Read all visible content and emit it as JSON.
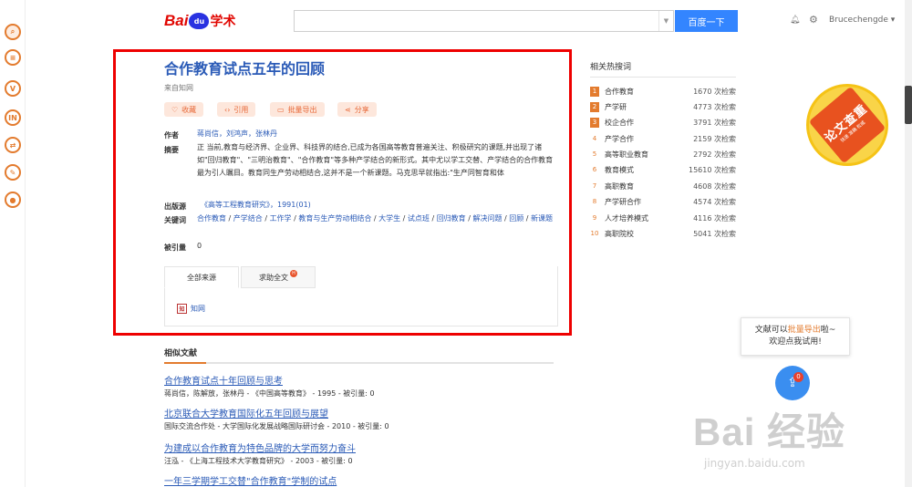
{
  "header": {
    "logo_text_a": "Bai",
    "logo_text_b": "du",
    "logo_text_c": "学术",
    "search_value": "",
    "search_button": "百度一下",
    "username": "Brucechengde ▾"
  },
  "paper": {
    "title": "合作教育试点五年的回顾",
    "source": "来自知网",
    "actions": [
      "收藏",
      "引用",
      "批量导出",
      "分享"
    ],
    "labels": {
      "authors": "作者",
      "abstract": "摘要",
      "publisher": "出版源",
      "keywords": "关键词",
      "cited": "被引量"
    },
    "authors": "蒋尚信，刘鸿声，张林丹",
    "abstract": "正 当前,教育与经济界、企业界、科技界的结合,已成为各国高等教育普遍关注、积极研究的课题,并出现了诸如\"回归教育\"、\"三明治教育\"、\"合作教育\"等多种产学结合的新形式。其中尤以学工交替、产学结合的合作教育最为引人瞩目。教育同生产劳动相结合,这并不是一个新课题。马克思早就指出:\"生产同智育和体",
    "publisher": "《高等工程教育研究》，1991(01)",
    "keywords": [
      "合作教育",
      "产学结合",
      "工作学",
      "教育与生产劳动相结合",
      "大学生",
      "试点班",
      "回归教育",
      "解决问题",
      "回顾",
      "新课题"
    ],
    "cited": "0",
    "tabs": [
      "全部来源",
      "求助全文"
    ],
    "tab_badge": "H",
    "source_link": "知网",
    "source_logo": "知"
  },
  "similar": {
    "heading": "相似文献",
    "items": [
      {
        "title": "合作教育试点十年回顾与思考",
        "meta": "蒋尚信，陈解放，张林丹 - 《中国高等教育》 - 1995 - 被引量: 0"
      },
      {
        "title": "北京联合大学教育国际化五年回顾与展望",
        "meta": "国际交流合作处 - 大学国际化发展战略国际研讨会 - 2010 - 被引量: 0"
      },
      {
        "title": "为建成以合作教育为特色品牌的大学而努力奋斗",
        "meta": "汪泓 - 《上海工程技术大学教育研究》 - 2003 - 被引量: 0"
      },
      {
        "title": "一年三学期学工交替\"合作教育\"学制的试点",
        "meta": ""
      }
    ]
  },
  "hot": {
    "heading": "相关热搜词",
    "items": [
      {
        "rank": "1",
        "name": "合作教育",
        "count": "1670 次检索"
      },
      {
        "rank": "2",
        "name": "产学研",
        "count": "4773 次检索"
      },
      {
        "rank": "3",
        "name": "校企合作",
        "count": "3791 次检索"
      },
      {
        "rank": "4",
        "name": "产学合作",
        "count": "2159 次检索"
      },
      {
        "rank": "5",
        "name": "高等职业教育",
        "count": "2792 次检索"
      },
      {
        "rank": "6",
        "name": "教育模式",
        "count": "15610 次检索"
      },
      {
        "rank": "7",
        "name": "高职教育",
        "count": "4608 次检索"
      },
      {
        "rank": "8",
        "name": "产学研合作",
        "count": "4574 次检索"
      },
      {
        "rank": "9",
        "name": "人才培养模式",
        "count": "4116 次检索"
      },
      {
        "rank": "10",
        "name": "高职院校",
        "count": "5041 次检索"
      }
    ]
  },
  "badge": {
    "big": "论文查重",
    "small": "快速 准确 权威"
  },
  "tip": {
    "pre": "文献可以",
    "hl": "批量导出",
    "post": "啦~",
    "line2": "欢迎点我试用!"
  },
  "float_badge": "0",
  "watermark": {
    "big": "Bai  经验",
    "sub": "jingyan.baidu.com"
  },
  "colors": {
    "accent": "#e37b2e",
    "link": "#2b5bb7",
    "highlight_box": "#e00000",
    "search_button": "#3385ff"
  }
}
